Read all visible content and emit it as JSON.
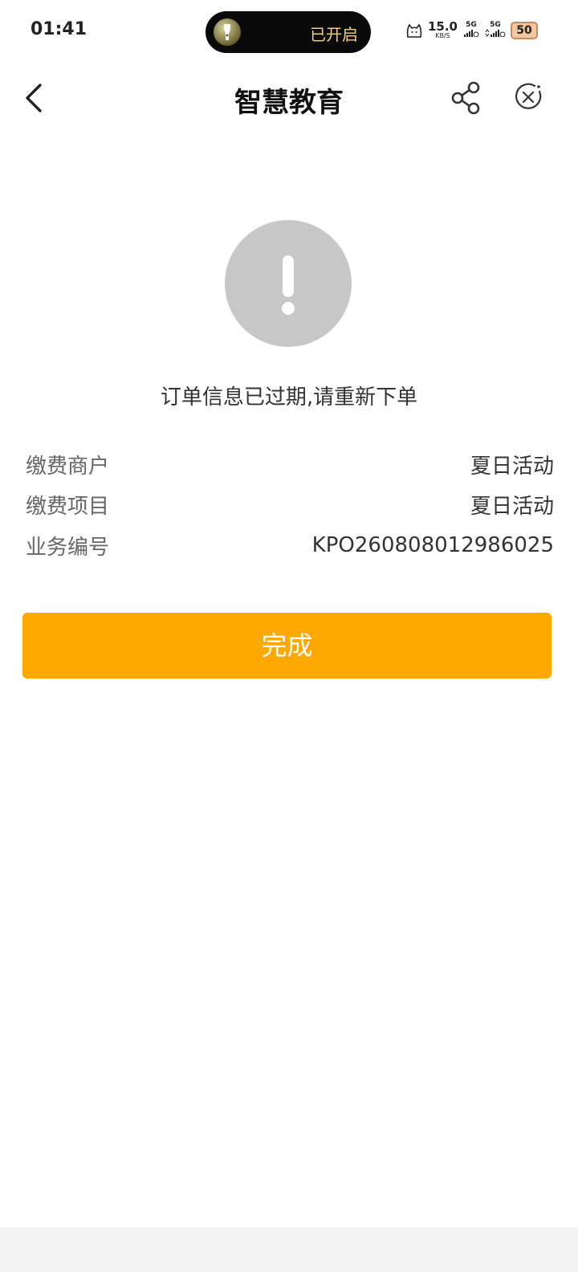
{
  "status_bar": {
    "time": "01:41",
    "flashlight_label": "已开启",
    "speed_value": "15.0",
    "speed_unit": "KB/S",
    "signal1": "5G",
    "signal2": "5G",
    "battery": "50"
  },
  "nav": {
    "title": "智慧教育"
  },
  "main": {
    "message": "订单信息已过期,请重新下单",
    "rows": [
      {
        "label": "缴费商户",
        "value": "夏日活动"
      },
      {
        "label": "缴费项目",
        "value": "夏日活动"
      },
      {
        "label": "业务编号",
        "value": "KPO260808012986025"
      }
    ],
    "done_label": "完成"
  },
  "colors": {
    "accent": "#ffa800",
    "alert_gray": "#c7c7c7"
  }
}
